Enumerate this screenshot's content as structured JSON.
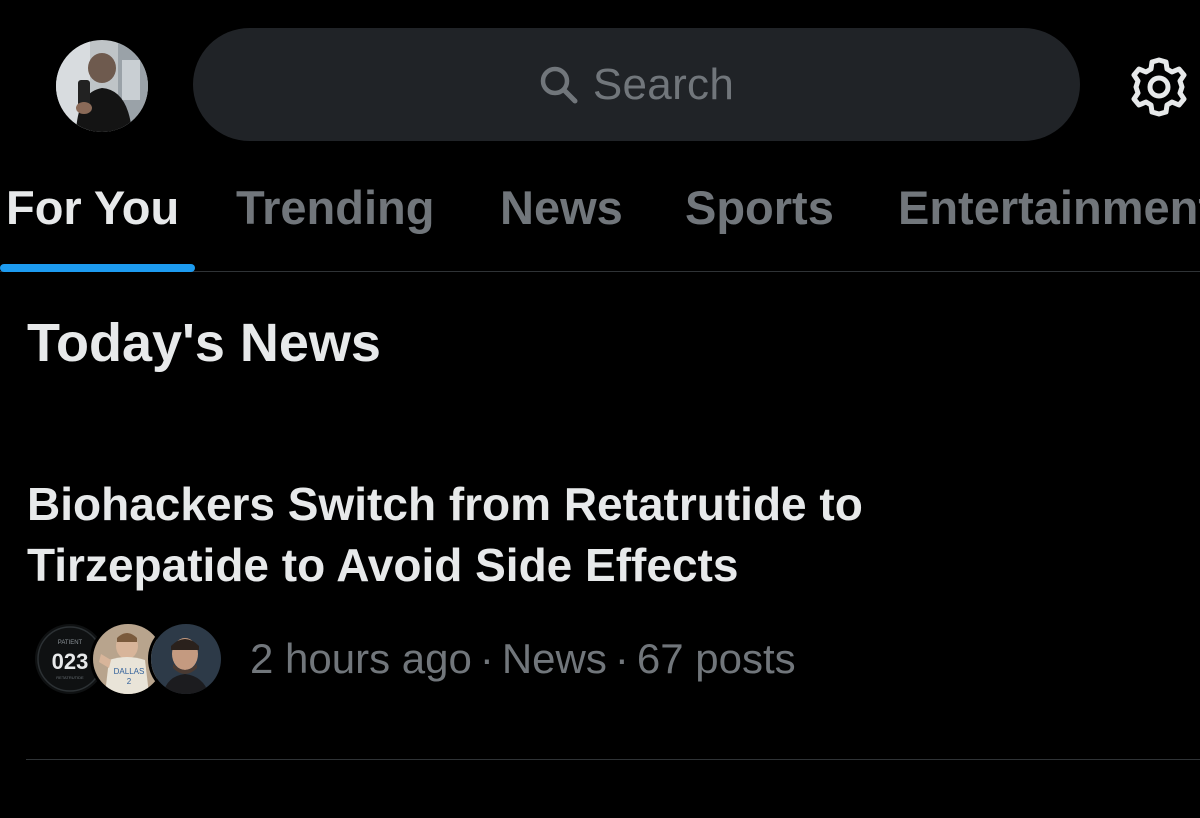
{
  "search": {
    "placeholder": "Search"
  },
  "tabs": [
    {
      "label": "For You",
      "active": true
    },
    {
      "label": "Trending",
      "active": false
    },
    {
      "label": "News",
      "active": false
    },
    {
      "label": "Sports",
      "active": false
    },
    {
      "label": "Entertainment",
      "active": false
    }
  ],
  "section": {
    "title": "Today's News"
  },
  "story": {
    "headline": "Biohackers Switch from Retatrutide to Tirzepatide to Avoid Side Effects",
    "time": "2 hours ago",
    "category": "News",
    "posts": "67 posts",
    "separator": "·",
    "avatars": [
      {
        "badge_top": "PATIENT",
        "badge_number": "023",
        "badge_bottom": "RETATRUTIDE"
      },
      {
        "jersey_text": "DALLAS",
        "jersey_number": "2"
      },
      {
        "name": ""
      }
    ]
  },
  "colors": {
    "background": "#000000",
    "text_primary": "#e7e9ea",
    "text_secondary": "#71767b",
    "accent": "#1d9bf0",
    "search_bg": "#202327",
    "divider": "#2f3336"
  },
  "icons": {
    "search": "search-icon",
    "settings": "gear-icon"
  }
}
